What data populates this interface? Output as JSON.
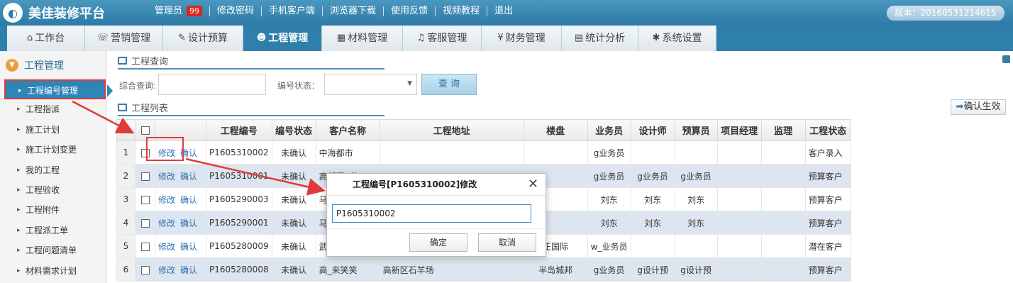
{
  "app": {
    "title": "美佳装修平台",
    "version": "版本：20160531214615"
  },
  "top_links": {
    "admin": "管理员",
    "badge": "99",
    "change_password": "修改密码",
    "mobile_client": "手机客户端",
    "browser_download": "浏览器下载",
    "feedback": "使用反馈",
    "video_tutorial": "视频教程",
    "logout": "退出"
  },
  "nav_tabs": [
    {
      "label": "工作台",
      "icon": "home-icon"
    },
    {
      "label": "营销管理",
      "icon": "chat-icon"
    },
    {
      "label": "设计预算",
      "icon": "edit-icon"
    },
    {
      "label": "工程管理",
      "icon": "users-icon"
    },
    {
      "label": "材料管理",
      "icon": "grid-icon"
    },
    {
      "label": "客服管理",
      "icon": "headphones-icon"
    },
    {
      "label": "财务管理",
      "icon": "yen-icon"
    },
    {
      "label": "统计分析",
      "icon": "chart-icon"
    },
    {
      "label": "系统设置",
      "icon": "gear-icon"
    }
  ],
  "sidebar": {
    "title": "工程管理",
    "items": [
      "工程编号管理",
      "工程指派",
      "施工计划",
      "施工计划变更",
      "我的工程",
      "工程验收",
      "工程附件",
      "工程派工单",
      "工程问题清单",
      "材料需求计划"
    ]
  },
  "query": {
    "section_title": "工程查询",
    "keyword_label": "综合查询:",
    "status_label": "编号状态：",
    "search_btn": "查 询"
  },
  "list": {
    "section_title": "工程列表",
    "confirm_btn": "确认生效",
    "headers": [
      "工程编号",
      "编号状态",
      "客户名称",
      "工程地址",
      "楼盘",
      "业务员",
      "设计师",
      "预算员",
      "项目经理",
      "监理",
      "工程状态"
    ],
    "edit_label": "修改",
    "confirm_label": "确认",
    "rows": [
      {
        "n": "1",
        "id": "P1605310002",
        "status": "未确认",
        "customer": "中海都市",
        "address": "",
        "estate": "",
        "sales": "g业务员",
        "designer": "",
        "budget": "",
        "pm": "",
        "supervisor": "",
        "state": "客户录入"
      },
      {
        "n": "2",
        "id": "P1605310001",
        "status": "未确认",
        "customer": "高新区A栋500",
        "address": "",
        "estate": "",
        "sales": "g业务员",
        "designer": "g业务员",
        "budget": "g业务员",
        "pm": "",
        "supervisor": "",
        "state": "预算客户"
      },
      {
        "n": "3",
        "id": "P1605290003",
        "status": "未确认",
        "customer": "马",
        "address": "",
        "estate": "",
        "sales": "刘东",
        "designer": "刘东",
        "budget": "刘东",
        "pm": "",
        "supervisor": "",
        "state": "预算客户"
      },
      {
        "n": "4",
        "id": "P1605290001",
        "status": "未确认",
        "customer": "马",
        "address": "",
        "estate": "",
        "sales": "刘东",
        "designer": "刘东",
        "budget": "刘东",
        "pm": "",
        "supervisor": "",
        "state": "预算客户"
      },
      {
        "n": "5",
        "id": "P1605280009",
        "status": "未确认",
        "customer": "武",
        "address": "",
        "estate": "正国际",
        "sales": "w_业务员",
        "designer": "",
        "budget": "",
        "pm": "",
        "supervisor": "",
        "state": "潜在客户"
      },
      {
        "n": "6",
        "id": "P1605280008",
        "status": "未确认",
        "customer": "高_来笑笑",
        "address": "高新区石羊场",
        "estate": "半岛城邦",
        "sales": "g业务员",
        "designer": "g设计预",
        "budget": "g设计预",
        "pm": "",
        "supervisor": "",
        "state": "预算客户"
      }
    ]
  },
  "dialog": {
    "title": "工程编号[P1605310002]修改",
    "value": "P1605310002",
    "ok": "确定",
    "cancel": "取消"
  },
  "colors": {
    "brand": "#2f7fab",
    "highlight": "#e03b3b",
    "row_alt": "#dde6f0"
  }
}
